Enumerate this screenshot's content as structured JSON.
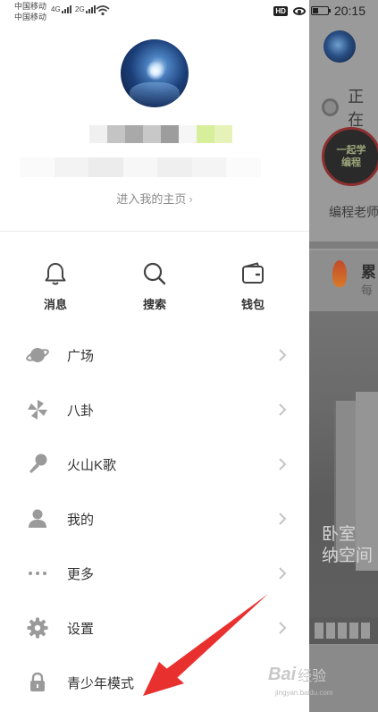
{
  "status_bar": {
    "carrier_1": "中国移动",
    "carrier_2": "中国移动",
    "net_1": "4G",
    "net_2": "2G",
    "hd_badge": "HD",
    "time": "20:15"
  },
  "profile": {
    "home_link": "进入我的主页",
    "home_chevron": "›"
  },
  "quick_actions": [
    {
      "label": "消息",
      "icon": "bell-icon"
    },
    {
      "label": "搜索",
      "icon": "search-icon"
    },
    {
      "label": "钱包",
      "icon": "wallet-icon"
    }
  ],
  "menu": [
    {
      "label": "广场",
      "icon": "planet-icon"
    },
    {
      "label": "八卦",
      "icon": "pinwheel-icon"
    },
    {
      "label": "火山K歌",
      "icon": "microphone-icon"
    },
    {
      "label": "我的",
      "icon": "person-icon"
    },
    {
      "label": "更多",
      "icon": "more-dots-icon"
    },
    {
      "label": "设置",
      "icon": "gear-icon"
    },
    {
      "label": "青少年模式",
      "icon": "lock-icon"
    }
  ],
  "background": {
    "live_text": "正在",
    "badge_line_1": "一起学",
    "badge_line_2": "编程",
    "teacher_text": "编程老师",
    "card_title": "累",
    "card_sub": "每",
    "photo_caption_1": "卧室",
    "photo_caption_2": "纳空间"
  },
  "watermark": {
    "brand": "Bai",
    "brand_cn": "经验",
    "url": "jingyan.baidu.com"
  },
  "colors": {
    "accent_arrow": "#e8312f",
    "icon_gray": "#9a9a9a",
    "text_dark": "#333333"
  }
}
